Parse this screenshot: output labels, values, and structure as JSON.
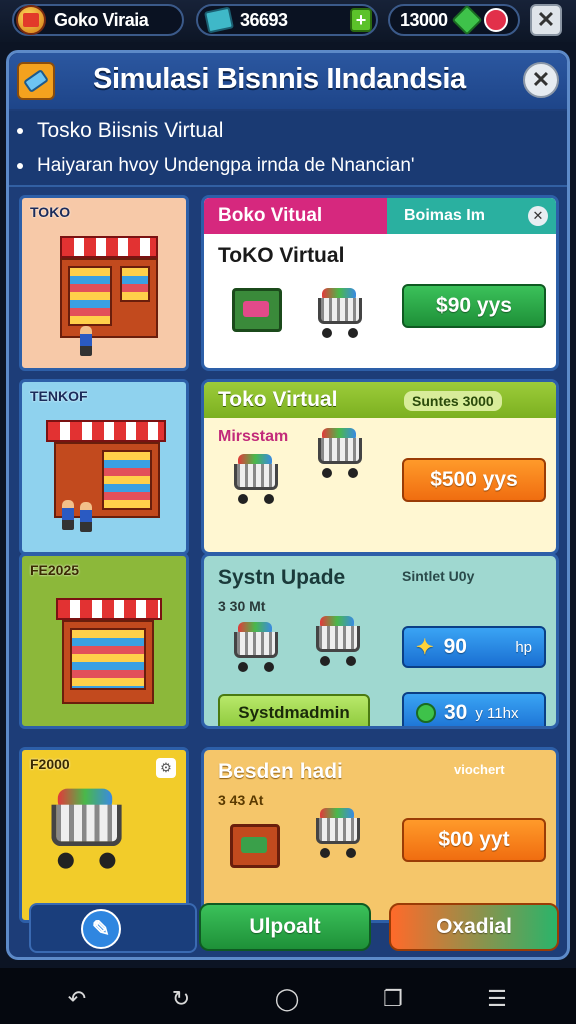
{
  "status_bar": {
    "player_name": "Goko Viraia",
    "cash_amount": "36693",
    "plus_label": "+",
    "gems_amount": "13000",
    "close_label": "✕"
  },
  "dialog": {
    "title": "Simulasi Bisnnis IIndandsia",
    "close_label": "✕",
    "bullets": [
      "Tosko Biisnis Virtual",
      "Haiyaran hvoy Undengpa irnda de Nnancian'"
    ]
  },
  "rows": [
    {
      "thumb_label": "TOKO",
      "header_title": "Boko Vitual",
      "header_badge": "Boimas Im",
      "subtitle": "ToKO Virtual",
      "button_label": "$90 yys",
      "thumb_color": "#f7c9a8"
    },
    {
      "thumb_label": "TENKOF",
      "header_title": "Toko Virtual",
      "header_badge": "Suntes 3000",
      "subtitle": "Mirsstam",
      "button_label": "$500 yys",
      "thumb_color": "#8fd2ee"
    },
    {
      "thumb_label": "FE2025",
      "header_title": "Systn Upade",
      "header_badge": "Sintlet U0y",
      "subtitle": "3 30 Mt",
      "button_label": "90",
      "button_unit": "hp",
      "button2_label": "30",
      "button2_unit": "y 11hx",
      "extra_button": "Systdmadmin",
      "thumb_color": "#8cb83a"
    },
    {
      "thumb_label": "F2000",
      "header_title": "Besden hadi",
      "header_badge": "viochert",
      "subtitle": "3 43 At",
      "button_label": "$00 yyt",
      "thumb_color": "#f2cc2a"
    }
  ],
  "footer": {
    "update_label": "Ulpoalt",
    "create_label": "Oxadial"
  },
  "colors": {
    "panel": "#1d3d78",
    "green": "#1e9038",
    "orange": "#f06d10",
    "blue": "#1a6fd2"
  }
}
